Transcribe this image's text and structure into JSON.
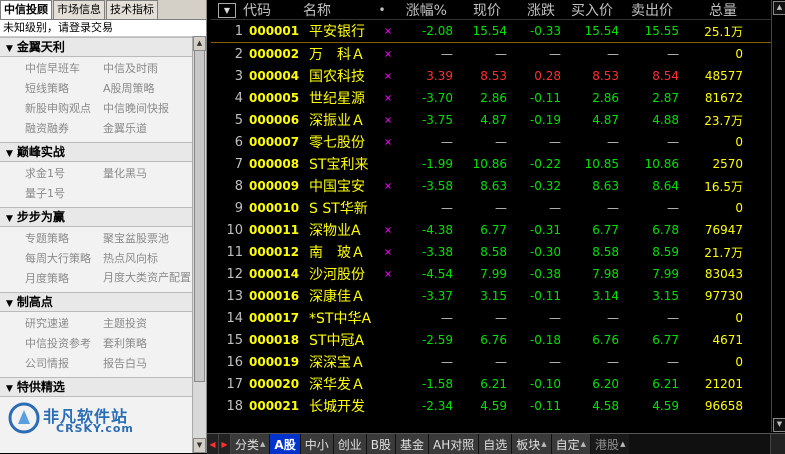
{
  "left": {
    "tabs": [
      "中信投顾",
      "市场信息",
      "技术指标"
    ],
    "login_text": "未知级别，请登录交易",
    "sections": [
      {
        "title": "金翼天利",
        "items": [
          "中信早班车",
          "中信及时雨",
          "短线策略",
          "A股周策略",
          "新股申购观点",
          "中信晚间快报",
          "融资融券",
          "金翼乐道"
        ]
      },
      {
        "title": "巅峰实战",
        "items": [
          "求金1号",
          "量化黑马",
          "量子1号"
        ]
      },
      {
        "title": "步步为赢",
        "items": [
          "专题策略",
          "聚宝盆股票池",
          "每周大行策略",
          "热点风向标",
          "月度策略",
          "月度大类资产配置"
        ]
      },
      {
        "title": "制高点",
        "items": [
          "研究速递",
          "主题投资",
          "中信投资参考",
          "套利策略",
          "公司情报",
          "报告白马"
        ]
      },
      {
        "title": "特供精选",
        "items": []
      }
    ],
    "watermark": {
      "title": "非凡软件站",
      "sub": "CRSKY.com"
    }
  },
  "grid": {
    "headers": {
      "code": "代码",
      "name": "名称",
      "mark": "•",
      "chg": "涨幅%",
      "price": "现价",
      "diff": "涨跌",
      "bid": "买入价",
      "ask": "卖出价",
      "vol": "总量"
    },
    "rows": [
      {
        "idx": "1",
        "code": "000001",
        "name": "平安银行",
        "mark": "×",
        "chg": "-2.08",
        "price": "15.54",
        "diff": "-0.33",
        "bid": "15.54",
        "ask": "15.55",
        "vol": "25.1万",
        "dir": "dn"
      },
      {
        "idx": "2",
        "code": "000002",
        "name": "万　科Ａ",
        "mark": "×",
        "chg": "—",
        "price": "—",
        "diff": "—",
        "bid": "—",
        "ask": "—",
        "vol": "0",
        "dir": "fl"
      },
      {
        "idx": "3",
        "code": "000004",
        "name": "国农科技",
        "mark": "×",
        "chg": "3.39",
        "price": "8.53",
        "diff": "0.28",
        "bid": "8.53",
        "ask": "8.54",
        "vol": "48577",
        "dir": "up"
      },
      {
        "idx": "4",
        "code": "000005",
        "name": "世纪星源",
        "mark": "×",
        "chg": "-3.70",
        "price": "2.86",
        "diff": "-0.11",
        "bid": "2.86",
        "ask": "2.87",
        "vol": "81672",
        "dir": "dn"
      },
      {
        "idx": "5",
        "code": "000006",
        "name": "深振业Ａ",
        "mark": "×",
        "chg": "-3.75",
        "price": "4.87",
        "diff": "-0.19",
        "bid": "4.87",
        "ask": "4.88",
        "vol": "23.7万",
        "dir": "dn"
      },
      {
        "idx": "6",
        "code": "000007",
        "name": "零七股份",
        "mark": "×",
        "chg": "—",
        "price": "—",
        "diff": "—",
        "bid": "—",
        "ask": "—",
        "vol": "0",
        "dir": "fl"
      },
      {
        "idx": "7",
        "code": "000008",
        "name": "ST宝利来",
        "mark": "",
        "chg": "-1.99",
        "price": "10.86",
        "diff": "-0.22",
        "bid": "10.85",
        "ask": "10.86",
        "vol": "2570",
        "dir": "dn"
      },
      {
        "idx": "8",
        "code": "000009",
        "name": "中国宝安",
        "mark": "×",
        "chg": "-3.58",
        "price": "8.63",
        "diff": "-0.32",
        "bid": "8.63",
        "ask": "8.64",
        "vol": "16.5万",
        "dir": "dn"
      },
      {
        "idx": "9",
        "code": "000010",
        "name": "S ST华新",
        "mark": "",
        "chg": "—",
        "price": "—",
        "diff": "—",
        "bid": "—",
        "ask": "—",
        "vol": "0",
        "dir": "fl"
      },
      {
        "idx": "10",
        "code": "000011",
        "name": "深物业A",
        "mark": "×",
        "chg": "-4.38",
        "price": "6.77",
        "diff": "-0.31",
        "bid": "6.77",
        "ask": "6.78",
        "vol": "76947",
        "dir": "dn"
      },
      {
        "idx": "11",
        "code": "000012",
        "name": "南　玻Ａ",
        "mark": "×",
        "chg": "-3.38",
        "price": "8.58",
        "diff": "-0.30",
        "bid": "8.58",
        "ask": "8.59",
        "vol": "21.7万",
        "dir": "dn"
      },
      {
        "idx": "12",
        "code": "000014",
        "name": "沙河股份",
        "mark": "×",
        "chg": "-4.54",
        "price": "7.99",
        "diff": "-0.38",
        "bid": "7.98",
        "ask": "7.99",
        "vol": "83043",
        "dir": "dn"
      },
      {
        "idx": "13",
        "code": "000016",
        "name": "深康佳Ａ",
        "mark": "",
        "chg": "-3.37",
        "price": "3.15",
        "diff": "-0.11",
        "bid": "3.14",
        "ask": "3.15",
        "vol": "97730",
        "dir": "dn"
      },
      {
        "idx": "14",
        "code": "000017",
        "name": "*ST中华A",
        "mark": "",
        "chg": "—",
        "price": "—",
        "diff": "—",
        "bid": "—",
        "ask": "—",
        "vol": "0",
        "dir": "fl"
      },
      {
        "idx": "15",
        "code": "000018",
        "name": "ST中冠A",
        "mark": "",
        "chg": "-2.59",
        "price": "6.76",
        "diff": "-0.18",
        "bid": "6.76",
        "ask": "6.77",
        "vol": "4671",
        "dir": "dn"
      },
      {
        "idx": "16",
        "code": "000019",
        "name": "深深宝Ａ",
        "mark": "",
        "chg": "—",
        "price": "—",
        "diff": "—",
        "bid": "—",
        "ask": "—",
        "vol": "0",
        "dir": "fl"
      },
      {
        "idx": "17",
        "code": "000020",
        "name": "深华发Ａ",
        "mark": "",
        "chg": "-1.58",
        "price": "6.21",
        "diff": "-0.10",
        "bid": "6.20",
        "ask": "6.21",
        "vol": "21201",
        "dir": "dn"
      },
      {
        "idx": "18",
        "code": "000021",
        "name": "长城开发",
        "mark": "",
        "chg": "-2.34",
        "price": "4.59",
        "diff": "-0.11",
        "bid": "4.58",
        "ask": "4.59",
        "vol": "96658",
        "dir": "dn"
      }
    ]
  },
  "bottom_tabs": [
    {
      "label": "分类",
      "arrow": true,
      "active": false,
      "dim": false
    },
    {
      "label": "A股",
      "arrow": false,
      "active": true,
      "dim": false
    },
    {
      "label": "中小",
      "arrow": false,
      "active": false,
      "dim": false
    },
    {
      "label": "创业",
      "arrow": false,
      "active": false,
      "dim": false
    },
    {
      "label": "B股",
      "arrow": false,
      "active": false,
      "dim": false
    },
    {
      "label": "基金",
      "arrow": false,
      "active": false,
      "dim": false
    },
    {
      "label": "AH对照",
      "arrow": false,
      "active": false,
      "dim": false
    },
    {
      "label": "自选",
      "arrow": false,
      "active": false,
      "dim": false
    },
    {
      "label": "板块",
      "arrow": true,
      "active": false,
      "dim": false
    },
    {
      "label": "自定",
      "arrow": true,
      "active": false,
      "dim": false
    },
    {
      "label": "港股",
      "arrow": true,
      "active": false,
      "dim": true
    }
  ],
  "colors": {
    "up": "#ff3030",
    "down": "#00e000",
    "flat": "#c0c0c0",
    "code": "#ffff00",
    "mark": "#ff00ff",
    "active_tab": "#0033cc"
  }
}
